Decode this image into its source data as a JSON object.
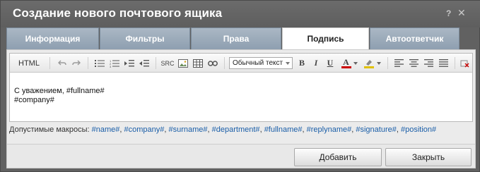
{
  "window": {
    "title": "Создание нового почтового ящика",
    "help_label": "?",
    "close_label": "✕"
  },
  "tabs": [
    {
      "label": "Информация",
      "active": false
    },
    {
      "label": "Фильтры",
      "active": false
    },
    {
      "label": "Права",
      "active": false
    },
    {
      "label": "Подпись",
      "active": true
    },
    {
      "label": "Автоответчик",
      "active": false
    }
  ],
  "toolbar": {
    "html_label": "HTML",
    "source_label": "SRC",
    "style_select_value": "Обычный текст",
    "bold_label": "B",
    "italic_label": "I",
    "underline_label": "U",
    "font_color_label": "A",
    "font_color": "#cc0000",
    "highlight_color": "#ffd700"
  },
  "editor": {
    "line1": "С уважением, #fullname#",
    "line2": "#company#"
  },
  "macros": {
    "label": "Допустимые макросы:",
    "items": [
      "#name#",
      "#company#",
      "#surname#",
      "#department#",
      "#fullname#",
      "#replyname#",
      "#signature#",
      "#position#"
    ]
  },
  "buttons": {
    "add_label": "Добавить",
    "close_label": "Закрыть"
  }
}
